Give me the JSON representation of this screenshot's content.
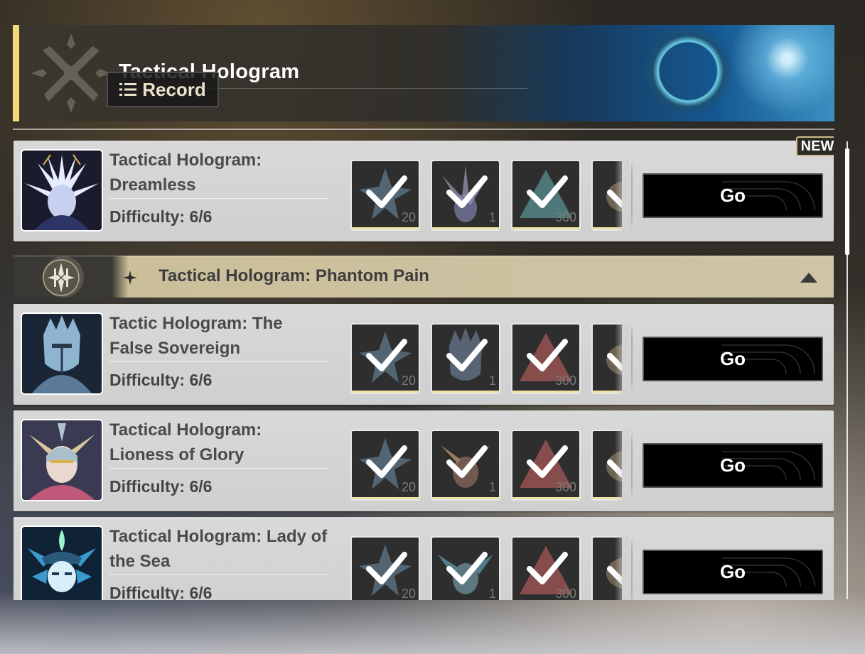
{
  "header": {
    "title": "Tactical Hologram",
    "record_label": "Record"
  },
  "cards": [
    {
      "title": "Tactical Hologram: Dreamless",
      "difficulty": "Difficulty: 6/6",
      "is_new": true,
      "new_label": "NEW",
      "rewards": [
        "20",
        "1",
        "300",
        ""
      ],
      "go_label": "Go",
      "portrait": "dreamless-portrait",
      "reward_colors": [
        "#8fb3c8",
        "#c8c8e8",
        "#7fb7b8",
        "#b0a48a"
      ]
    },
    {
      "title": "Tactic Hologram: The False Sovereign",
      "difficulty": "Difficulty: 6/6",
      "rewards": [
        "20",
        "1",
        "300",
        ""
      ],
      "go_label": "Go",
      "portrait": "false-sovereign-portrait",
      "reward_colors": [
        "#8fb3c8",
        "#7f8ea8",
        "#c07070",
        "#b0a48a"
      ]
    },
    {
      "title": "Tactical Hologram: Lioness of Glory",
      "difficulty": "Difficulty: 6/6",
      "rewards": [
        "20",
        "1",
        "300",
        ""
      ],
      "go_label": "Go",
      "portrait": "lioness-of-glory-portrait",
      "reward_colors": [
        "#8fb3c8",
        "#c8a68a",
        "#c07070",
        "#b0a48a"
      ]
    },
    {
      "title": "Tactical Hologram: Lady of the Sea",
      "difficulty": "Difficulty: 6/6",
      "rewards": [
        "20",
        "1",
        "300",
        ""
      ],
      "go_label": "Go",
      "portrait": "lady-of-the-sea-portrait",
      "reward_colors": [
        "#8fb3c8",
        "#7fb0b8",
        "#c07070",
        "#b0a48a"
      ]
    }
  ],
  "section": {
    "title": "Tactical Hologram: Phantom Pain",
    "expanded": true
  },
  "colors": {
    "accent": "#f1d97a",
    "card_bg": "#d4d4d4",
    "go_bg": "#000000"
  }
}
